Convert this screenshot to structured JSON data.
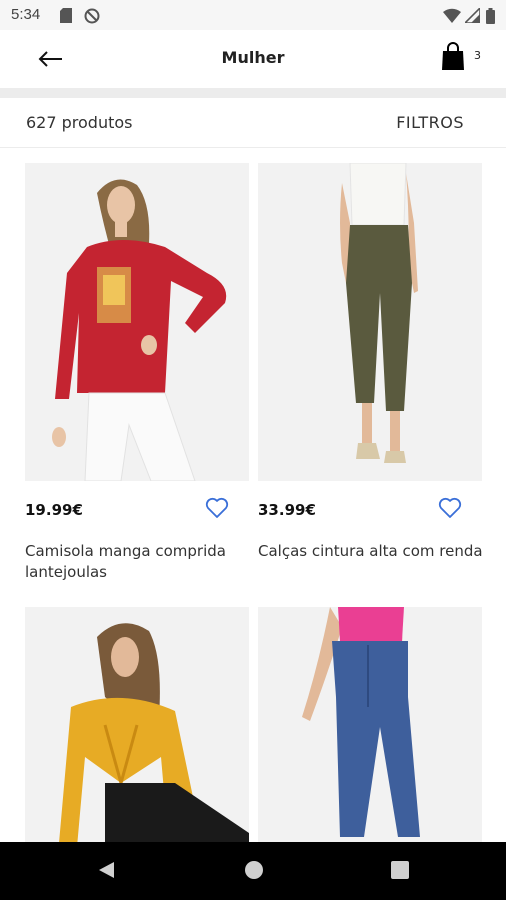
{
  "status_bar": {
    "time": "5:34",
    "icons": [
      "sd-card-icon",
      "do-not-disturb-icon",
      "wifi-icon",
      "cell-signal-icon",
      "battery-icon"
    ]
  },
  "header": {
    "title": "Mulher",
    "cart_count": "3",
    "back_icon": "arrow-left-icon",
    "cart_icon": "shopping-bag-icon"
  },
  "toolbar": {
    "product_count": "627 produtos",
    "filters_label": "FILTROS"
  },
  "products": [
    {
      "price": "19.99€",
      "name": "Camisola manga comprida lantejoulas",
      "image": "model in red sweater and white jeans"
    },
    {
      "price": "33.99€",
      "name": "Calças cintura alta com renda",
      "image": "model in white top and olive trousers"
    },
    {
      "price": "",
      "name": "",
      "image": "model in yellow satin crop top"
    },
    {
      "price": "",
      "name": "",
      "image": "model in pink top and blue skinny jeans"
    }
  ],
  "nav_bar": {
    "icons": [
      "back-triangle-icon",
      "home-circle-icon",
      "recents-square-icon"
    ]
  },
  "colors": {
    "accent": "#3a6fd8",
    "nav": "#000000",
    "status": "#f6f6f6"
  }
}
